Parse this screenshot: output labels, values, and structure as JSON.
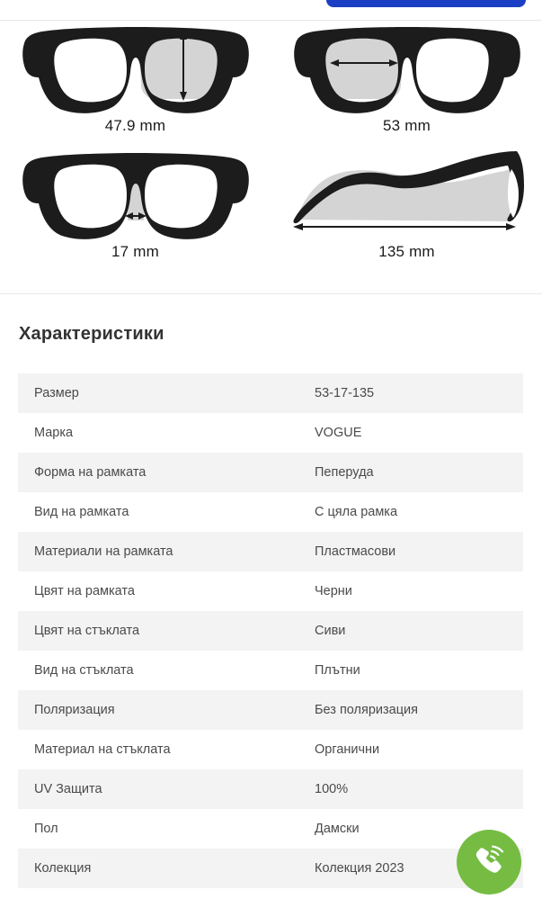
{
  "top_cta": {
    "name": "primary-action-button",
    "color": "#1a3fc4",
    "label": ""
  },
  "measurements": {
    "items": [
      {
        "id": "lens-height",
        "icon": "glasses-front-lens-height-icon",
        "label": "47.9 mm"
      },
      {
        "id": "lens-width",
        "icon": "glasses-front-lens-width-icon",
        "label": "53 mm"
      },
      {
        "id": "bridge-width",
        "icon": "glasses-front-bridge-width-icon",
        "label": "17 mm"
      },
      {
        "id": "temple-length",
        "icon": "glasses-temple-length-icon",
        "label": "135 mm"
      }
    ]
  },
  "characteristics": {
    "title": "Характеристики",
    "rows": [
      {
        "key": "Размер",
        "value": "53-17-135"
      },
      {
        "key": "Марка",
        "value": "VOGUE"
      },
      {
        "key": "Форма на рамката",
        "value": "Пеперуда"
      },
      {
        "key": "Вид на рамката",
        "value": "С цяла рамка"
      },
      {
        "key": "Материали на рамката",
        "value": "Пластмасови"
      },
      {
        "key": "Цвят на рамката",
        "value": "Черни"
      },
      {
        "key": "Цвят на стъклата",
        "value": "Сиви"
      },
      {
        "key": "Вид на стъклата",
        "value": "Плътни"
      },
      {
        "key": "Поляризация",
        "value": "Без поляризация"
      },
      {
        "key": "Материал на стъклата",
        "value": "Органични"
      },
      {
        "key": "UV Защита",
        "value": "100%"
      },
      {
        "key": "Пол",
        "value": "Дамски"
      },
      {
        "key": "Колекция",
        "value": "Колекция 2023"
      }
    ]
  },
  "fab": {
    "icon": "phone-call-icon",
    "color": "#76bc43",
    "label": ""
  },
  "colors": {
    "frame_dark": "#1c1c1c",
    "lens_highlight": "#d4d4d4",
    "stripe": "#f3f3f3",
    "text": "#4a4a4a",
    "accent_blue": "#1a3fc4",
    "accent_green": "#76bc43"
  }
}
